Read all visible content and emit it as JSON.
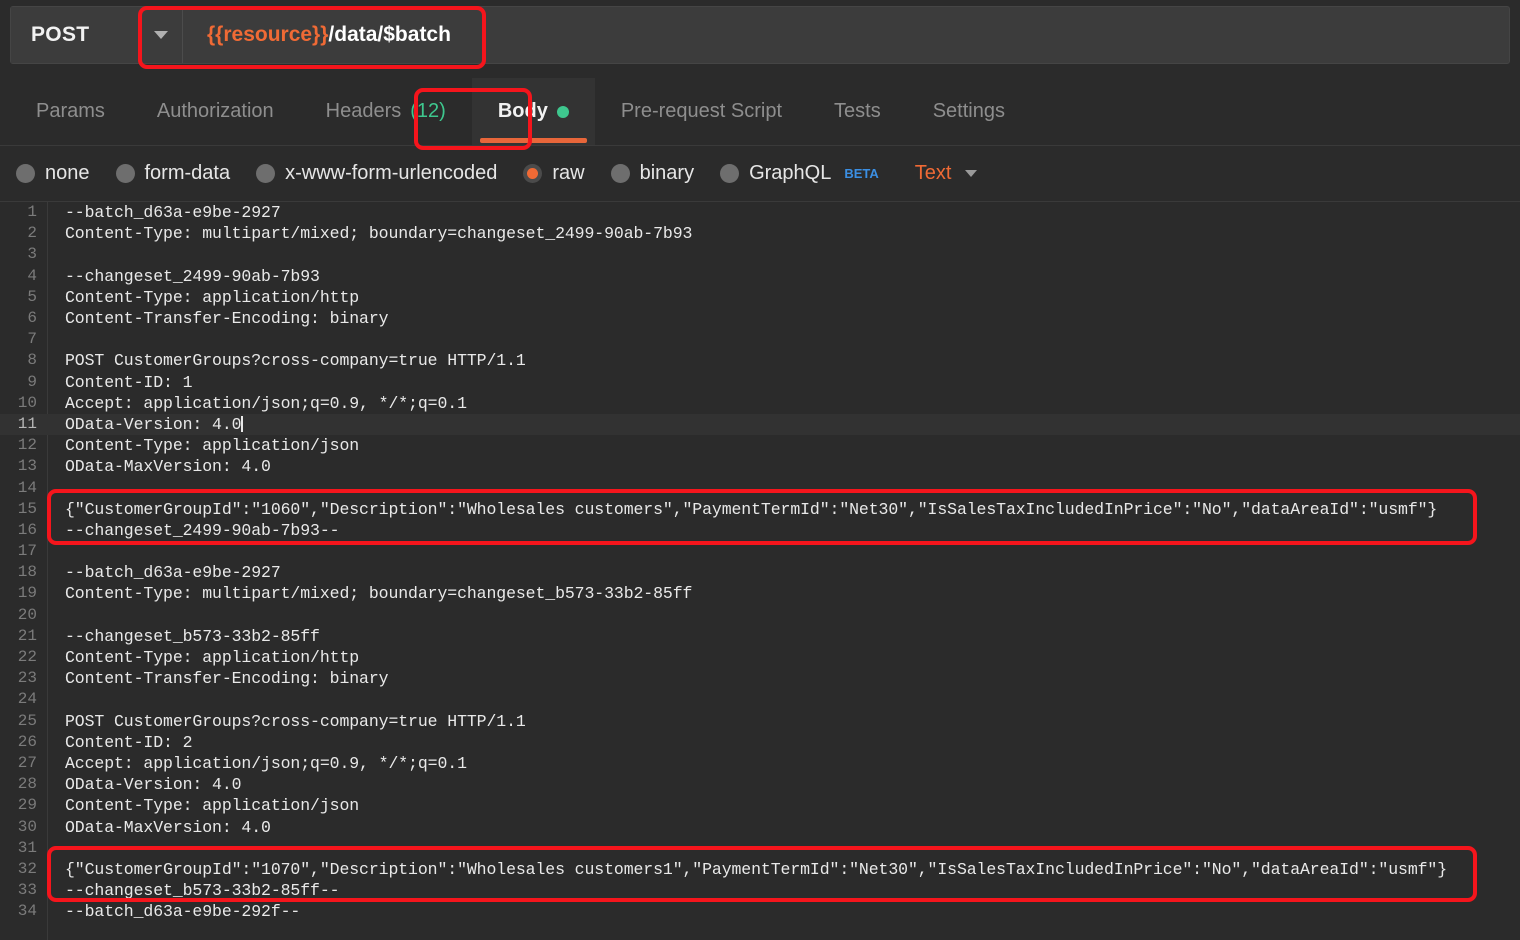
{
  "request_bar": {
    "method": "POST",
    "method_caret_icon": "chevron-down-icon",
    "url_variable": "{{resource}}",
    "url_rest": "/data/$batch"
  },
  "tabs": [
    {
      "label": "Params",
      "active": false
    },
    {
      "label": "Authorization",
      "active": false
    },
    {
      "label": "Headers",
      "count": "(12)",
      "active": false
    },
    {
      "label": "Body",
      "active": true,
      "dot": "green-status-dot"
    },
    {
      "label": "Pre-request Script",
      "active": false
    },
    {
      "label": "Tests",
      "active": false
    },
    {
      "label": "Settings",
      "active": false
    }
  ],
  "body_types": [
    {
      "label": "none",
      "selected": false
    },
    {
      "label": "form-data",
      "selected": false
    },
    {
      "label": "x-www-form-urlencoded",
      "selected": false
    },
    {
      "label": "raw",
      "selected": true
    },
    {
      "label": "binary",
      "selected": false
    },
    {
      "label": "GraphQL",
      "selected": false,
      "badge": "BETA"
    }
  ],
  "format_select": {
    "value": "Text",
    "caret_icon": "chevron-down-icon"
  },
  "editor": {
    "active_line": 11,
    "lines": [
      {
        "n": "1",
        "text": "--batch_d63a-e9be-2927"
      },
      {
        "n": "2",
        "text": "Content-Type: multipart/mixed; boundary=changeset_2499-90ab-7b93"
      },
      {
        "n": "3",
        "text": ""
      },
      {
        "n": "4",
        "text": "--changeset_2499-90ab-7b93"
      },
      {
        "n": "5",
        "text": "Content-Type: application/http"
      },
      {
        "n": "6",
        "text": "Content-Transfer-Encoding: binary"
      },
      {
        "n": "7",
        "text": ""
      },
      {
        "n": "8",
        "text": "POST CustomerGroups?cross-company=true HTTP/1.1"
      },
      {
        "n": "9",
        "text": "Content-ID: 1"
      },
      {
        "n": "10",
        "text": "Accept: application/json;q=0.9, */*;q=0.1"
      },
      {
        "n": "11",
        "text": "OData-Version: 4.0"
      },
      {
        "n": "12",
        "text": "Content-Type: application/json"
      },
      {
        "n": "13",
        "text": "OData-MaxVersion: 4.0"
      },
      {
        "n": "14",
        "text": ""
      },
      {
        "n": "15",
        "text": "{\"CustomerGroupId\":\"1060\",\"Description\":\"Wholesales customers\",\"PaymentTermId\":\"Net30\",\"IsSalesTaxIncludedInPrice\":\"No\",\"dataAreaId\":\"usmf\"}"
      },
      {
        "n": "16",
        "text": "--changeset_2499-90ab-7b93--"
      },
      {
        "n": "17",
        "text": ""
      },
      {
        "n": "18",
        "text": "--batch_d63a-e9be-2927"
      },
      {
        "n": "19",
        "text": "Content-Type: multipart/mixed; boundary=changeset_b573-33b2-85ff"
      },
      {
        "n": "20",
        "text": ""
      },
      {
        "n": "21",
        "text": "--changeset_b573-33b2-85ff"
      },
      {
        "n": "22",
        "text": "Content-Type: application/http"
      },
      {
        "n": "23",
        "text": "Content-Transfer-Encoding: binary"
      },
      {
        "n": "24",
        "text": ""
      },
      {
        "n": "25",
        "text": "POST CustomerGroups?cross-company=true HTTP/1.1"
      },
      {
        "n": "26",
        "text": "Content-ID: 2"
      },
      {
        "n": "27",
        "text": "Accept: application/json;q=0.9, */*;q=0.1"
      },
      {
        "n": "28",
        "text": "OData-Version: 4.0"
      },
      {
        "n": "29",
        "text": "Content-Type: application/json"
      },
      {
        "n": "30",
        "text": "OData-MaxVersion: 4.0"
      },
      {
        "n": "31",
        "text": ""
      },
      {
        "n": "32",
        "text": "{\"CustomerGroupId\":\"1070\",\"Description\":\"Wholesales customers1\",\"PaymentTermId\":\"Net30\",\"IsSalesTaxIncludedInPrice\":\"No\",\"dataAreaId\":\"usmf\"}"
      },
      {
        "n": "33",
        "text": "--changeset_b573-33b2-85ff--"
      },
      {
        "n": "34",
        "text": "--batch_d63a-e9be-292f--"
      }
    ]
  },
  "annotations": {
    "color": "#f5151c",
    "boxes": [
      {
        "name": "url-input-highlight"
      },
      {
        "name": "body-tab-highlight"
      },
      {
        "name": "first-payload-highlight"
      },
      {
        "name": "second-payload-highlight"
      }
    ]
  },
  "colors": {
    "accent_orange": "#f06a35",
    "status_green": "#3ec78e",
    "beta_blue": "#3b8fe3",
    "annotation_red": "#f5151c",
    "editor_bg": "#2b2b2b"
  }
}
